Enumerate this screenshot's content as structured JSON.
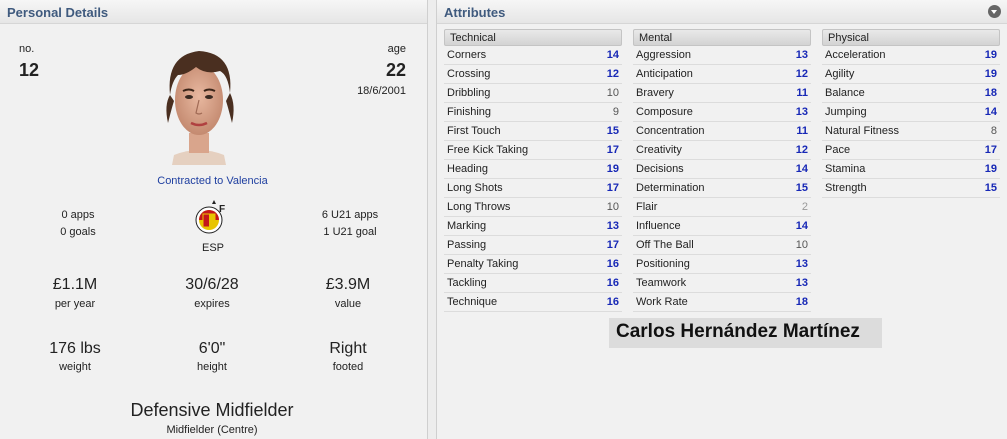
{
  "left_panel": {
    "title": "Personal Details",
    "number_label": "no.",
    "number": "12",
    "age_label": "age",
    "age": "22",
    "dob": "18/6/2001",
    "contract": "Contracted to Valencia",
    "apps": "0 apps",
    "goals": "0 goals",
    "nation": "ESP",
    "u21_apps": "6 U21 apps",
    "u21_goals": "1 U21 goal",
    "wage": "£1.1M",
    "wage_label": "per year",
    "expires": "30/6/28",
    "expires_label": "expires",
    "value": "£3.9M",
    "value_label": "value",
    "weight": "176 lbs",
    "weight_label": "weight",
    "height": "6'0\"",
    "height_label": "height",
    "foot": "Right",
    "foot_label": "footed",
    "position": "Defensive Midfielder",
    "position_detail": "Midfielder (Centre)"
  },
  "right_panel": {
    "title": "Attributes",
    "player_name": "Carlos Hernández Martínez",
    "technical": {
      "header": "Technical",
      "items": [
        {
          "name": "Corners",
          "value": "14"
        },
        {
          "name": "Crossing",
          "value": "12"
        },
        {
          "name": "Dribbling",
          "value": "10"
        },
        {
          "name": "Finishing",
          "value": "9"
        },
        {
          "name": "First Touch",
          "value": "15"
        },
        {
          "name": "Free Kick Taking",
          "value": "17"
        },
        {
          "name": "Heading",
          "value": "19"
        },
        {
          "name": "Long Shots",
          "value": "17"
        },
        {
          "name": "Long Throws",
          "value": "10"
        },
        {
          "name": "Marking",
          "value": "13"
        },
        {
          "name": "Passing",
          "value": "17"
        },
        {
          "name": "Penalty Taking",
          "value": "16"
        },
        {
          "name": "Tackling",
          "value": "16"
        },
        {
          "name": "Technique",
          "value": "16"
        }
      ]
    },
    "mental": {
      "header": "Mental",
      "items": [
        {
          "name": "Aggression",
          "value": "13"
        },
        {
          "name": "Anticipation",
          "value": "12"
        },
        {
          "name": "Bravery",
          "value": "11"
        },
        {
          "name": "Composure",
          "value": "13"
        },
        {
          "name": "Concentration",
          "value": "11"
        },
        {
          "name": "Creativity",
          "value": "12"
        },
        {
          "name": "Decisions",
          "value": "14"
        },
        {
          "name": "Determination",
          "value": "15"
        },
        {
          "name": "Flair",
          "value": "2"
        },
        {
          "name": "Influence",
          "value": "14"
        },
        {
          "name": "Off The Ball",
          "value": "10"
        },
        {
          "name": "Positioning",
          "value": "13"
        },
        {
          "name": "Teamwork",
          "value": "13"
        },
        {
          "name": "Work Rate",
          "value": "18"
        }
      ]
    },
    "physical": {
      "header": "Physical",
      "items": [
        {
          "name": "Acceleration",
          "value": "19"
        },
        {
          "name": "Agility",
          "value": "19"
        },
        {
          "name": "Balance",
          "value": "18"
        },
        {
          "name": "Jumping",
          "value": "14"
        },
        {
          "name": "Natural Fitness",
          "value": "8"
        },
        {
          "name": "Pace",
          "value": "17"
        },
        {
          "name": "Stamina",
          "value": "19"
        },
        {
          "name": "Strength",
          "value": "15"
        }
      ]
    }
  },
  "colors": {
    "title_blue": "#3f5a7e",
    "value_high": "#1728b6",
    "value_low": "#555555",
    "link": "#1f3fa0"
  }
}
